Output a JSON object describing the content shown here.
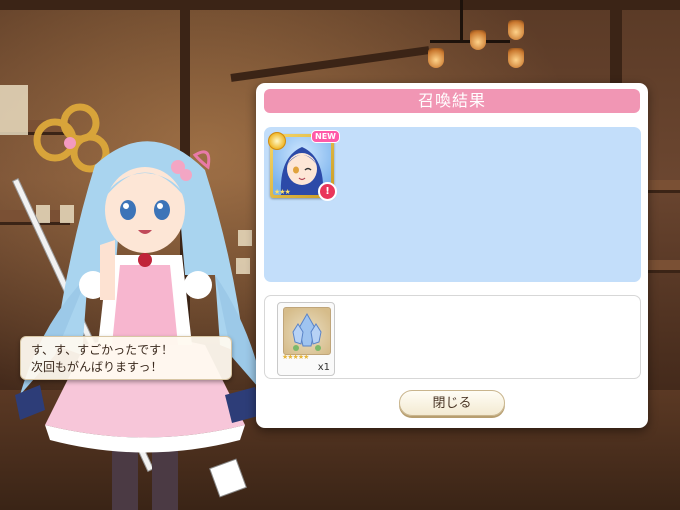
{
  "dialogue": {
    "line1": "す、す、すごかったです！",
    "line2": "次回もがんばりますっ！"
  },
  "result_panel": {
    "title": "召喚結果",
    "summoned": [
      {
        "icon": "character-card-icon",
        "new_badge": "NEW",
        "alert": "!"
      }
    ],
    "items": [
      {
        "icon": "crystal-item-icon",
        "quantity": "x1"
      }
    ],
    "close_label": "閉じる"
  },
  "colors": {
    "title_bar": "#f196b4",
    "result_area": "#c3defa",
    "panel": "#ffffff"
  }
}
